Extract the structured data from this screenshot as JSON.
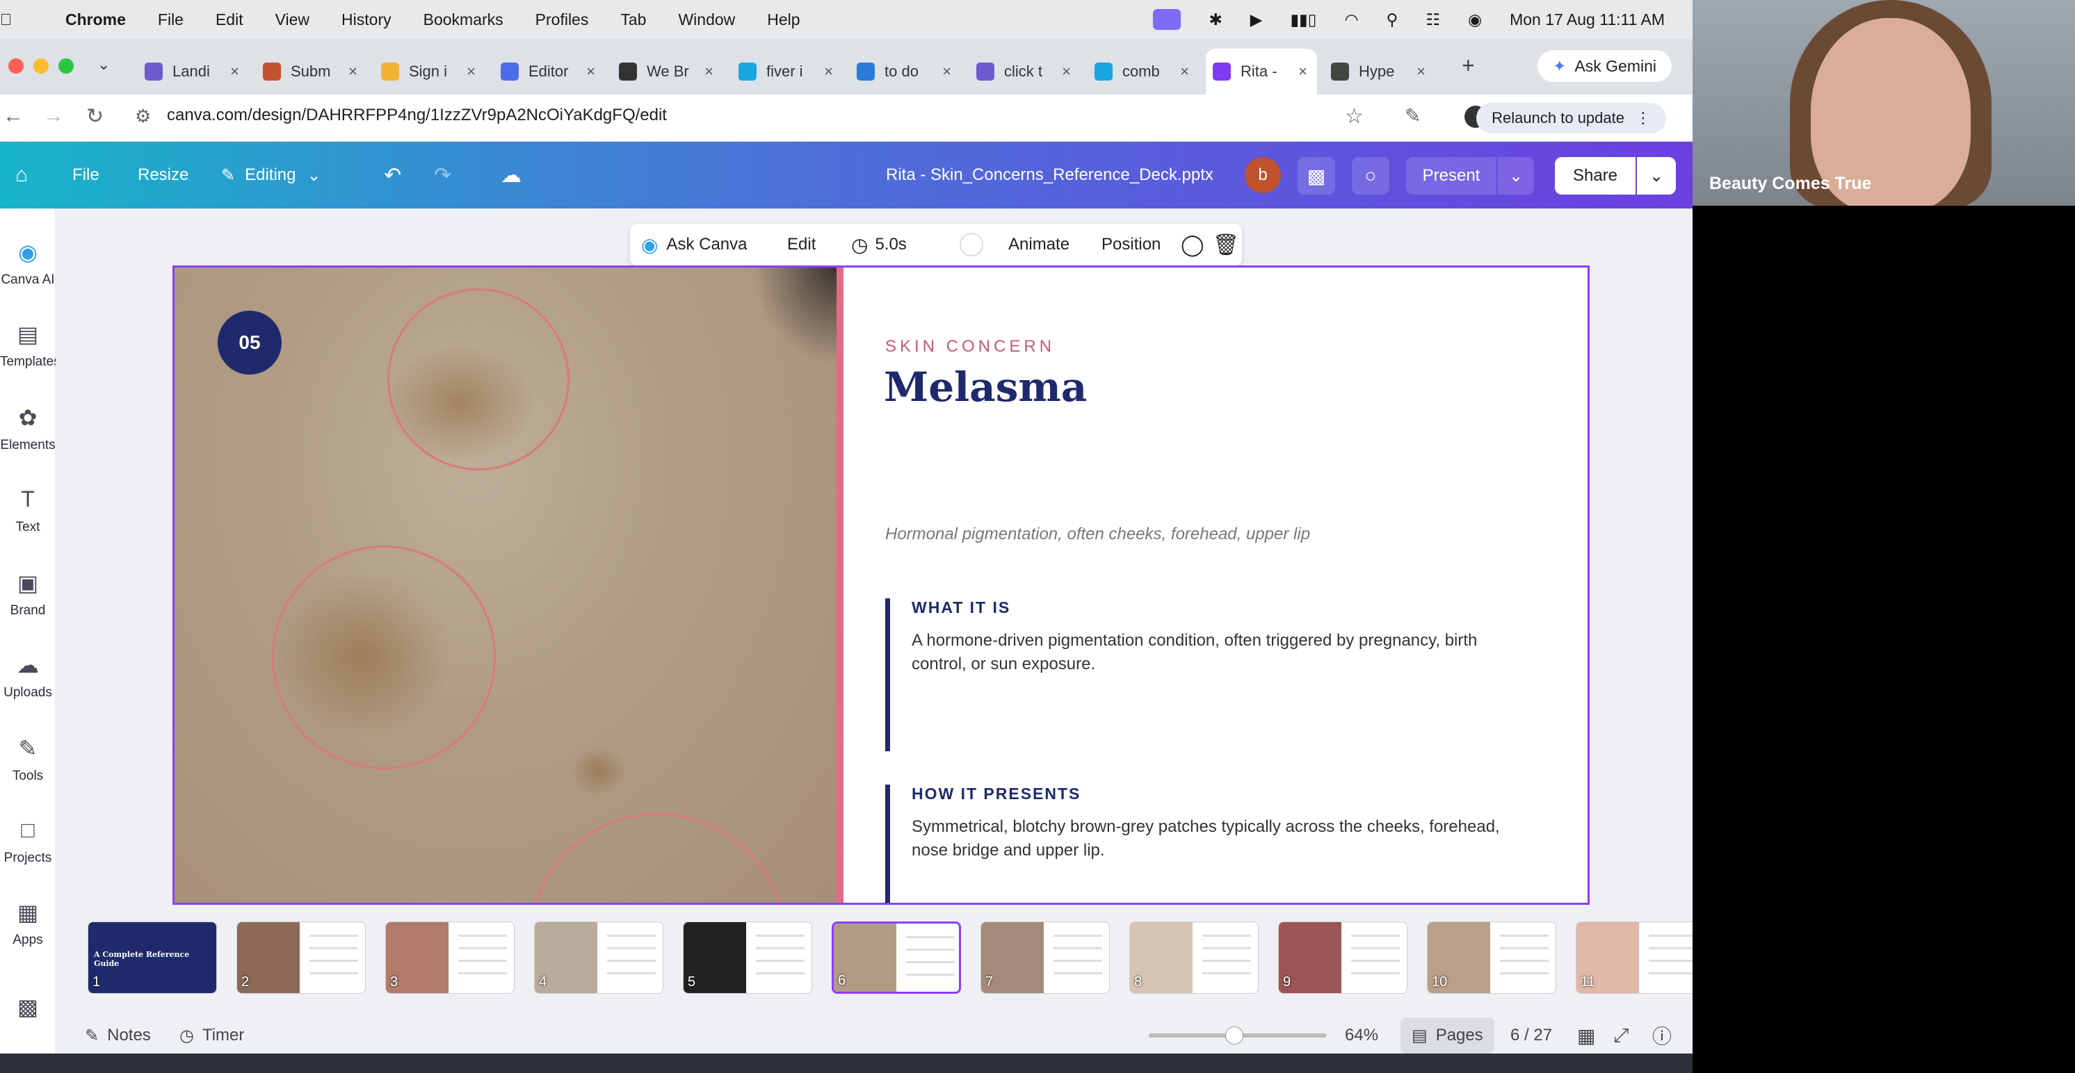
{
  "menubar": {
    "app": "Chrome",
    "items": [
      "File",
      "Edit",
      "View",
      "History",
      "Bookmarks",
      "Profiles",
      "Tab",
      "Window",
      "Help"
    ],
    "datetime": "Mon 17 Aug  11:11 AM"
  },
  "tabs": [
    {
      "label": "Landi",
      "color": "#6d5bd0"
    },
    {
      "label": "Subm",
      "color": "#c0532e"
    },
    {
      "label": "Sign i",
      "color": "#f2b233"
    },
    {
      "label": "Editor",
      "color": "#4b6ee8"
    },
    {
      "label": "We Br",
      "color": "#333333"
    },
    {
      "label": "fiver i",
      "color": "#1aa6e0"
    },
    {
      "label": "to do",
      "color": "#2a7ad8"
    },
    {
      "label": "click t",
      "color": "#6d5bd0"
    },
    {
      "label": "comb",
      "color": "#1aa6e0"
    },
    {
      "label": "Rita -",
      "color": "#7d3cf0"
    },
    {
      "label": "Hype",
      "color": "#444444"
    }
  ],
  "browser": {
    "gemini": "Ask Gemini",
    "url": "canva.com/design/DAHRRFPP4ng/1IzzZVr9pA2NcOiYaKdgFQ/edit",
    "relaunch": "Relaunch to update"
  },
  "canva_header": {
    "file": "File",
    "resize": "Resize",
    "editing": "Editing",
    "doc_title": "Rita - Skin_Concerns_Reference_Deck.pptx",
    "avatar_letter": "b",
    "present": "Present",
    "share": "Share"
  },
  "sidebar": {
    "items": [
      {
        "label": "Canva AI",
        "icon": "canva-ai-icon"
      },
      {
        "label": "Templates",
        "icon": "templates-icon"
      },
      {
        "label": "Elements",
        "icon": "elements-icon"
      },
      {
        "label": "Text",
        "icon": "text-icon"
      },
      {
        "label": "Brand",
        "icon": "brand-icon"
      },
      {
        "label": "Uploads",
        "icon": "uploads-icon"
      },
      {
        "label": "Tools",
        "icon": "tools-icon"
      },
      {
        "label": "Projects",
        "icon": "projects-icon"
      },
      {
        "label": "Apps",
        "icon": "apps-icon"
      }
    ]
  },
  "floating_toolbar": {
    "ask_canva": "Ask Canva",
    "edit": "Edit",
    "duration": "5.0s",
    "animate": "Animate",
    "position": "Position"
  },
  "slide": {
    "number": "05",
    "kicker": "SKIN CONCERN",
    "title": "Melasma",
    "subtitle": "Hormonal pigmentation, often cheeks, forehead, upper lip",
    "sections": [
      {
        "heading": "WHAT IT IS",
        "body": "A hormone-driven pigmentation condition, often triggered by pregnancy, birth control, or sun exposure."
      },
      {
        "heading": "HOW IT PRESENTS",
        "body": "Symmetrical, blotchy brown-grey patches typically across the cheeks, forehead, nose bridge and upper lip."
      }
    ]
  },
  "filmstrip": {
    "pages": [
      "1",
      "2",
      "3",
      "4",
      "5",
      "6",
      "7",
      "8",
      "9",
      "10",
      "11"
    ],
    "selected": "6",
    "first_title": "A Complete Reference Guide"
  },
  "footer": {
    "notes": "Notes",
    "timer": "Timer",
    "zoom": "64%",
    "pages": "Pages",
    "page_count": "6 / 27"
  },
  "webcam": {
    "name": "Beauty Comes True"
  }
}
